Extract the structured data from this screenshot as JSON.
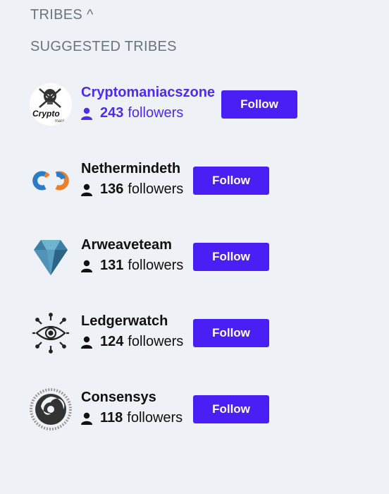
{
  "header": {
    "title": "TRIBES",
    "toggle_glyph": "^"
  },
  "suggested": {
    "title": "SUGGESTED TRIBES"
  },
  "tribes": [
    {
      "name": "Cryptomaniacszone",
      "count": "243",
      "followers_label": "followers",
      "follow_label": "Follow",
      "avatar_text": "Crypto",
      "avatar_subtext": "mani",
      "icon": "skull-logo-icon"
    },
    {
      "name": "Nethermindeth",
      "count": "136",
      "followers_label": "followers",
      "follow_label": "Follow",
      "icon": "nethermind-logo-icon"
    },
    {
      "name": "Arweaveteam",
      "count": "131",
      "followers_label": "followers",
      "follow_label": "Follow",
      "icon": "diamond-logo-icon"
    },
    {
      "name": "Ledgerwatch",
      "count": "124",
      "followers_label": "followers",
      "follow_label": "Follow",
      "icon": "eye-logo-icon"
    },
    {
      "name": "Consensys",
      "count": "118",
      "followers_label": "followers",
      "follow_label": "Follow",
      "icon": "swirl-logo-icon"
    }
  ],
  "colors": {
    "accent": "#4a1ff5",
    "active_text": "#4a2df0",
    "header_text": "#6b7280",
    "background": "#eef1f5"
  }
}
